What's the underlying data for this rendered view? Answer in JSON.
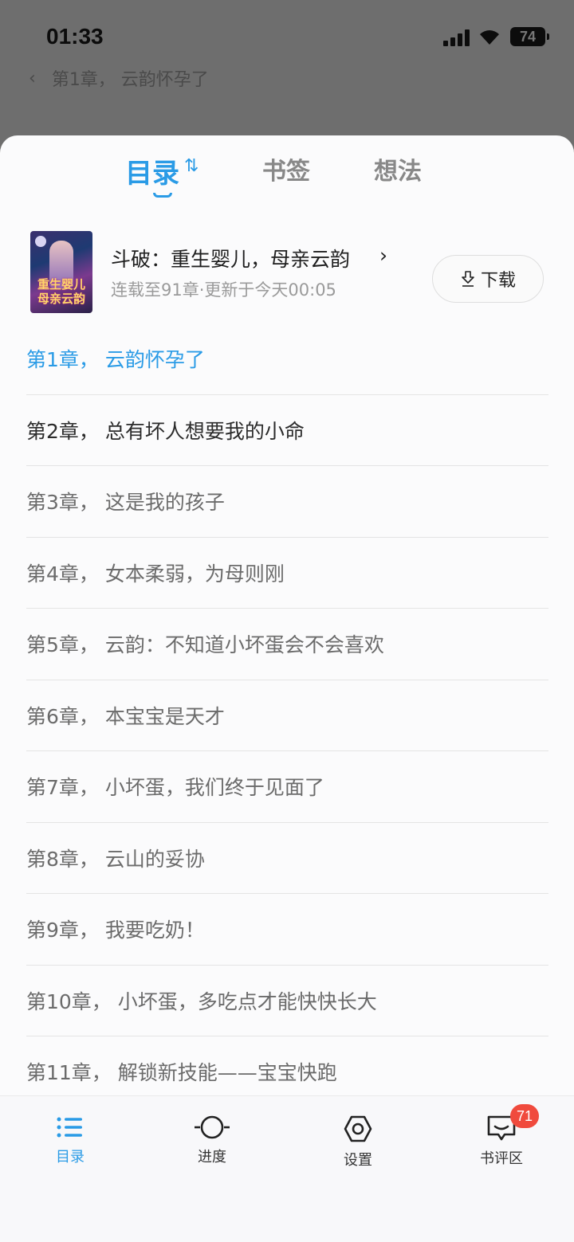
{
  "status_bar": {
    "time": "01:33",
    "battery": "74"
  },
  "reader_header": {
    "chapter_title": "第1章， 云韵怀孕了"
  },
  "tabs": [
    {
      "label": "目录"
    },
    {
      "label": "书签"
    },
    {
      "label": "想法"
    }
  ],
  "book": {
    "title": "斗破：重生婴儿，母亲云韵",
    "cover_text": "重生婴儿 母亲云韵",
    "meta": "连载至91章·更新于今天00:05",
    "download_label": "下载"
  },
  "chapters": [
    "第1章， 云韵怀孕了",
    "第2章， 总有坏人想要我的小命",
    "第3章， 这是我的孩子",
    "第4章， 女本柔弱，为母则刚",
    "第5章， 云韵：不知道小坏蛋会不会喜欢",
    "第6章， 本宝宝是天才",
    "第7章， 小坏蛋，我们终于见面了",
    "第8章， 云山的妥协",
    "第9章， 我要吃奶！",
    "第10章， 小坏蛋，多吃点才能快快长大",
    "第11章， 解锁新技能——宝宝快跑"
  ],
  "bottom_nav": {
    "toc": "目录",
    "progress": "进度",
    "settings": "设置",
    "review": "书评区",
    "review_badge": "71"
  },
  "colors": {
    "accent": "#2a9be6",
    "badge": "#f04a3d"
  }
}
